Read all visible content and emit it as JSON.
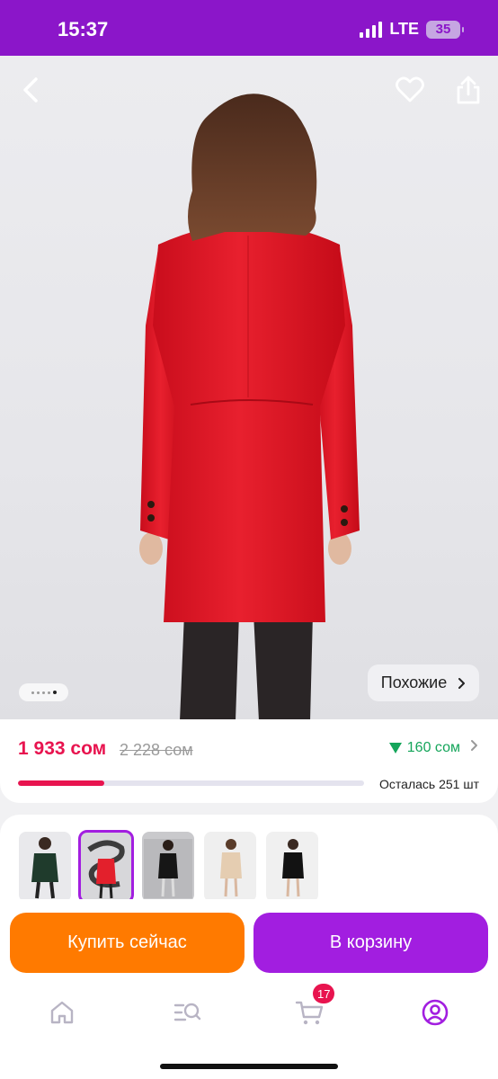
{
  "status_bar": {
    "time": "15:37",
    "network": "LTE",
    "battery": "35",
    "icons": [
      "signal-icon",
      "battery-icon"
    ]
  },
  "product": {
    "price": "1 933 сом",
    "old_price": "2 228 сом",
    "discount": "160 сом",
    "stock_label": "Осталась 251 шт",
    "stock_progress_percent": 25,
    "gallery_count": 5,
    "gallery_active_index": 4
  },
  "hero": {
    "similar_label": "Похожие",
    "icons": [
      "back-icon",
      "heart-icon",
      "share-icon",
      "chevron-right-icon"
    ]
  },
  "variants": {
    "count": 5,
    "selected_index": 1
  },
  "actions": {
    "buy_now_label": "Купить сейчас",
    "add_to_cart_label": "В корзину"
  },
  "tabbar": {
    "cart_badge": "17",
    "icons": [
      "home-icon",
      "catalog-search-icon",
      "cart-icon",
      "profile-icon"
    ],
    "colors": {
      "active": "#a21ee0",
      "inactive": "#b8b4c4"
    }
  },
  "colors": {
    "brand": "#8b16c9",
    "accent": "#a21ee0",
    "price": "#e8144f",
    "buy_now": "#ff7a00",
    "discount": "#14a55a"
  }
}
